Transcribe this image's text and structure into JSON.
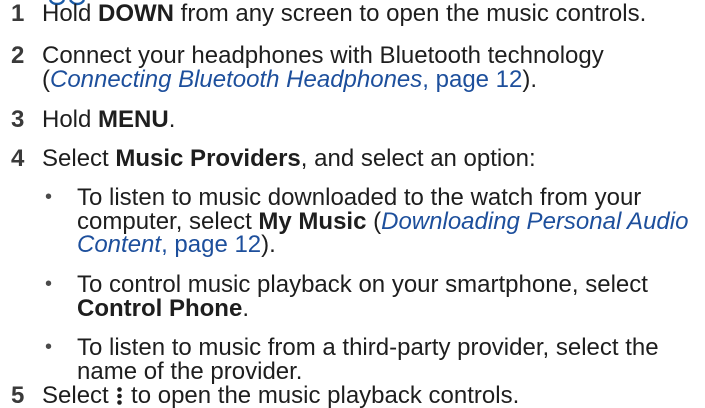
{
  "colors": {
    "heading": "#1a5aa6",
    "link": "#1d4f9c",
    "text": "#1e1e1e",
    "step_number": "#3a3a3a"
  },
  "bullet_glyph": "•",
  "steps": {
    "s1": {
      "number": "1",
      "t1": "Hold ",
      "b1": "DOWN",
      "t2": " from any screen to open the music controls."
    },
    "s2": {
      "number": "2",
      "line1": "Connect your headphones with Bluetooth technology",
      "open": "(",
      "link": "Connecting Bluetooth Headphones",
      "page": ", page 12",
      "close": ")."
    },
    "s3": {
      "number": "3",
      "t1": "Hold ",
      "b1": "MENU",
      "t2": "."
    },
    "s4": {
      "number": "4",
      "t1": "Select ",
      "b1": "Music Providers",
      "t2": ", and select an option:"
    },
    "s5": {
      "number": "5",
      "t1": "Select ",
      "icon": "vertical-ellipsis-icon",
      "t2": " to open the music playback controls."
    }
  },
  "options": {
    "o1": {
      "line1": "To listen to music downloaded to the watch from your",
      "t1": "computer, select ",
      "b1": "My Music",
      "open": " (",
      "link_a": "Downloading Personal Audio",
      "link_b": "Content",
      "page": ", page 12",
      "close": ")."
    },
    "o2": {
      "line1": "To control music playback on your smartphone, select",
      "b1": "Control Phone",
      "t2": "."
    },
    "o3": {
      "line1": "To listen to music from a third-party provider, select the",
      "line2": "name of the provider."
    }
  }
}
